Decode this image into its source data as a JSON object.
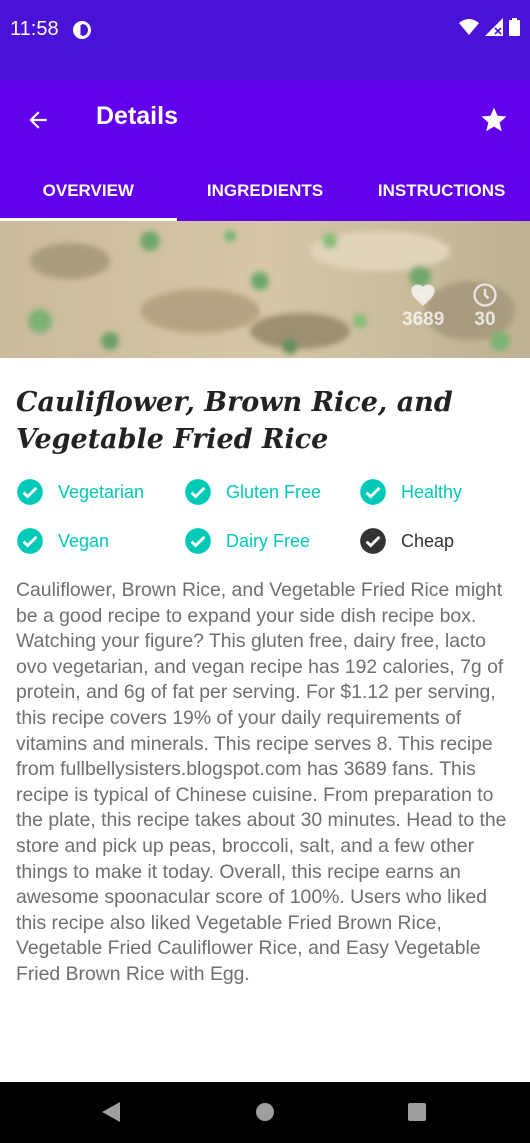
{
  "status_bar": {
    "time": "11:58"
  },
  "app_bar": {
    "title": "Details"
  },
  "tabs": [
    {
      "label": "OVERVIEW",
      "active": true
    },
    {
      "label": "INGREDIENTS",
      "active": false
    },
    {
      "label": "INSTRUCTIONS",
      "active": false
    }
  ],
  "hero": {
    "likes": "3689",
    "minutes": "30"
  },
  "recipe": {
    "title": "Cauliflower, Brown Rice, and Vegetable Fried Rice",
    "tags": [
      {
        "label": "Vegetarian",
        "checked": true
      },
      {
        "label": "Gluten Free",
        "checked": true
      },
      {
        "label": "Healthy",
        "checked": true
      },
      {
        "label": "Vegan",
        "checked": true
      },
      {
        "label": "Dairy Free",
        "checked": true
      },
      {
        "label": "Cheap",
        "checked": false
      }
    ],
    "summary": "Cauliflower, Brown Rice, and Vegetable Fried Rice might be a good recipe to expand your side dish recipe box. Watching your figure? This gluten free, dairy free, lacto ovo vegetarian, and vegan recipe has 192 calories, 7g of protein, and 6g of fat per serving. For $1.12 per serving, this recipe covers 19% of your daily requirements of vitamins and minerals. This recipe serves 8. This recipe from fullbellysisters.blogspot.com has 3689 fans. This recipe is typical of Chinese cuisine. From preparation to the plate, this recipe takes about 30 minutes. Head to the store and pick up peas, broccoli, salt, and a few other things to make it today. Overall, this recipe earns an awesome spoonacular score of 100%. Users who liked this recipe also liked Vegetable Fried Brown Rice, Vegetable Fried Cauliflower Rice, and Easy Vegetable Fried Brown Rice with Egg."
  },
  "colors": {
    "primary": "#6200ee",
    "status": "#4a12d6",
    "accent": "#00c9b7"
  }
}
